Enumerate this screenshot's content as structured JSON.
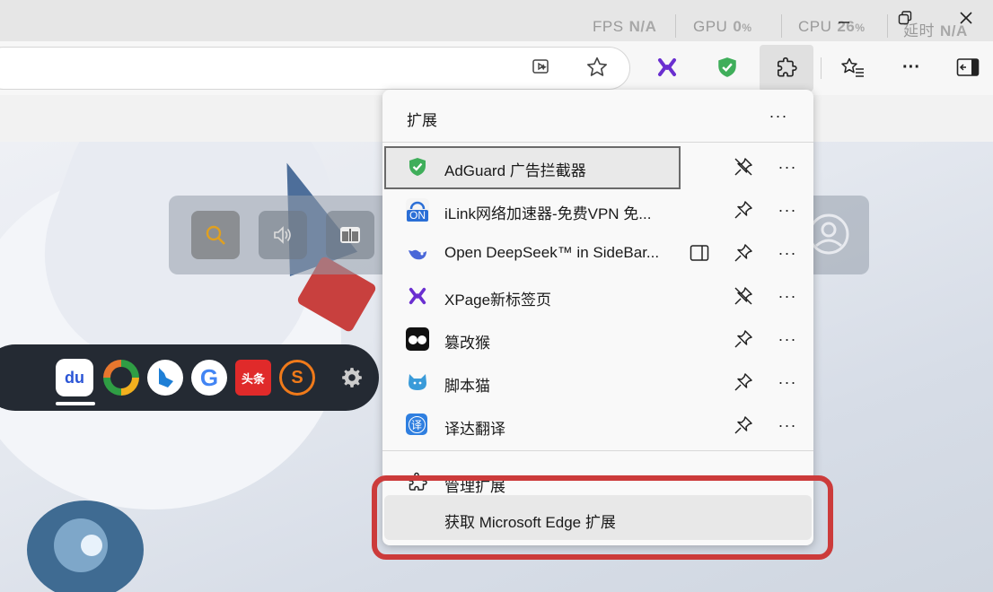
{
  "perf": {
    "fps_label": "FPS",
    "fps_value": "N/A",
    "gpu_label": "GPU",
    "gpu_value": "0",
    "gpu_unit": "%",
    "cpu_label": "CPU",
    "cpu_value": "26",
    "cpu_unit": "%",
    "latency_label": "延时",
    "latency_value": "N/A"
  },
  "toolbar": {
    "read_aloud_icon": "image-search-icon",
    "favorite_icon": "star-icon",
    "xpage_icon": "xpage-icon",
    "adguard_icon": "shield-check-icon",
    "extensions_icon": "puzzle-icon",
    "favorites_icon": "favorites-list-icon",
    "more_label": "···",
    "sidebar_icon": "sidebar-icon"
  },
  "menu": {
    "title": "扩展",
    "more_label": "···",
    "items": [
      {
        "name": "AdGuard 广告拦截器",
        "icon": "adguard-shield-icon",
        "pinned": true
      },
      {
        "name": "iLink网络加速器-免费VPN 免...",
        "icon": "ilink-icon",
        "icon_text": "ON",
        "pinned": false
      },
      {
        "name": "Open DeepSeek™ in SideBar...",
        "icon": "deepseek-icon",
        "pinned": false
      },
      {
        "name": "XPage新标签页",
        "icon": "xpage-icon",
        "pinned": true
      },
      {
        "name": "篡改猴",
        "icon": "tampermonkey-icon",
        "pinned": false
      },
      {
        "name": "脚本猫",
        "icon": "scriptcat-icon",
        "pinned": false
      },
      {
        "name": "译达翻译",
        "icon": "translate-icon",
        "icon_text": "译",
        "pinned": false
      }
    ],
    "manage_label": "管理扩展",
    "get_label": "获取 Microsoft Edge 扩展"
  },
  "dock": {
    "baidu_text": "du",
    "toutiao_text": "头条"
  },
  "colors": {
    "accent": "#cc3b3b",
    "adguard_green": "#3fae5a",
    "xpage_purple": "#6a2fd0",
    "dock_bg": "#242a33"
  }
}
